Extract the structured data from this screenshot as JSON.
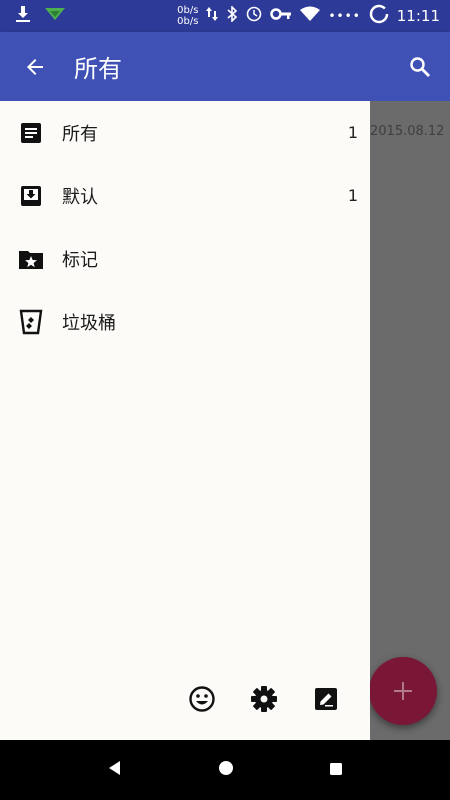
{
  "status_bar": {
    "net_up": "0b/s",
    "net_down": "0b/s",
    "dots": "••••",
    "time": "11:11"
  },
  "app_bar": {
    "title": "所有"
  },
  "background": {
    "date": "2015.08.12"
  },
  "drawer": {
    "items": [
      {
        "label": "所有",
        "count": "1",
        "icon": "notes-icon"
      },
      {
        "label": "默认",
        "count": "1",
        "icon": "inbox-icon"
      },
      {
        "label": "标记",
        "count": "",
        "icon": "starred-folder-icon"
      },
      {
        "label": "垃圾桶",
        "count": "",
        "icon": "trash-icon"
      }
    ],
    "footer": [
      "emoji-icon",
      "settings-icon",
      "edit-icon"
    ]
  },
  "colors": {
    "primary": "#3f51b5",
    "status": "#2e3a97",
    "fab": "#7b1736",
    "drawer_bg": "#fcfbf7"
  }
}
